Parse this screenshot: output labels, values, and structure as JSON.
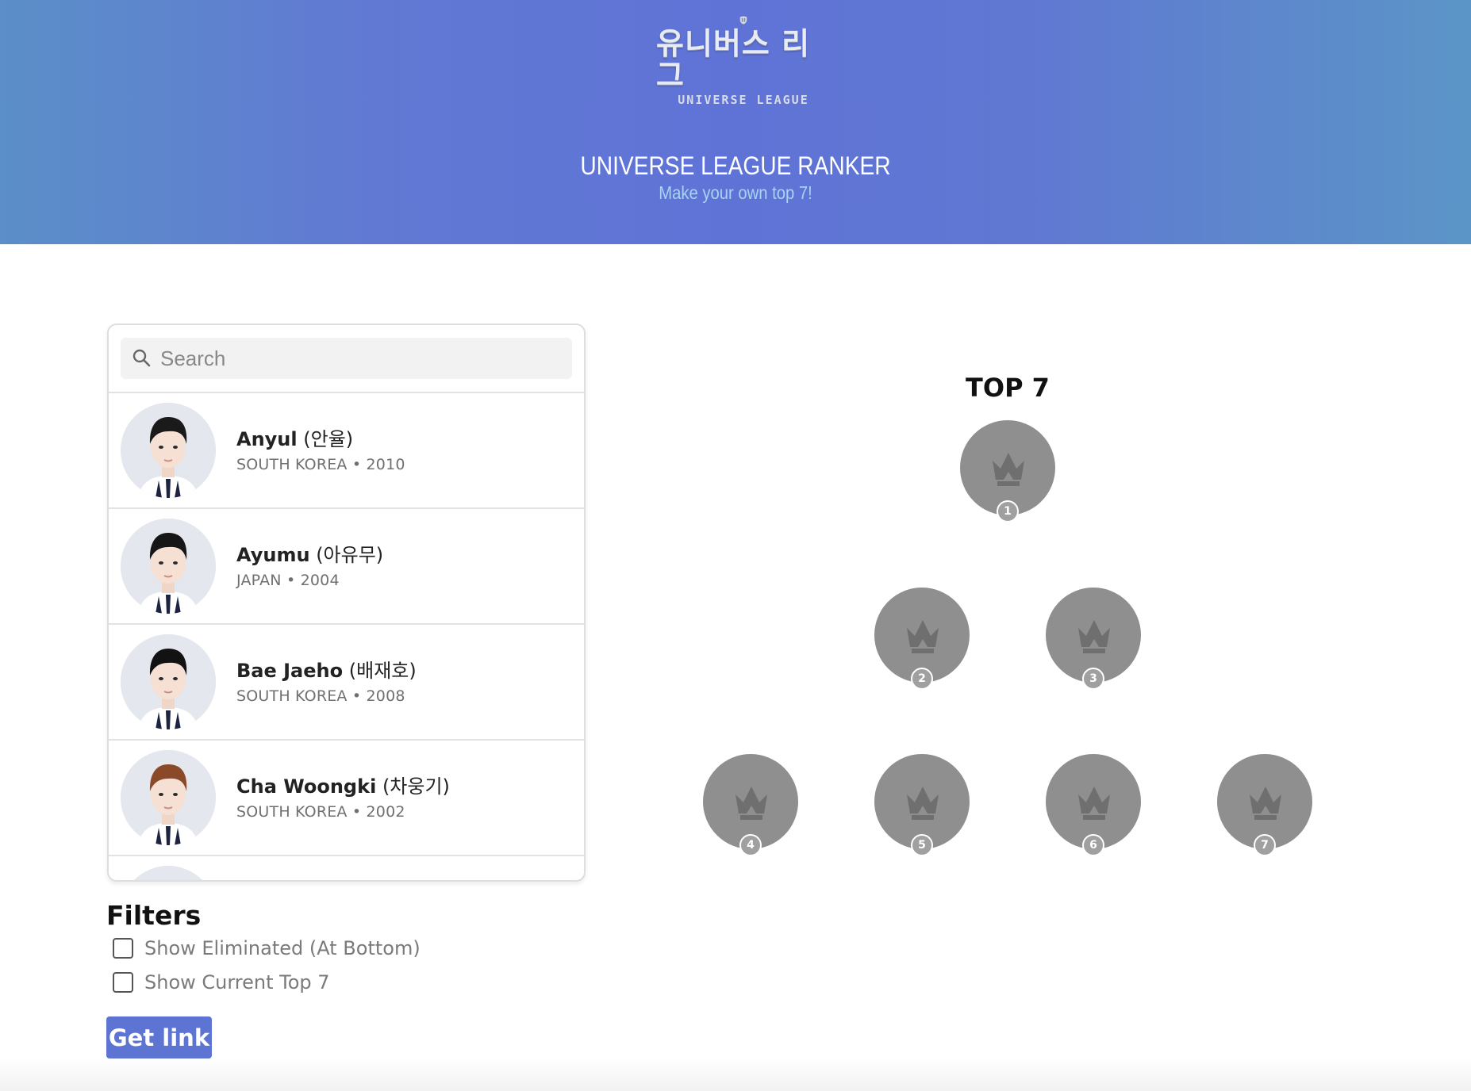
{
  "header": {
    "logo_korean": "유니버스 리그",
    "logo_english": "UNIVERSE LEAGUE",
    "title": "UNIVERSE LEAGUE RANKER",
    "subtitle": "Make your own top 7!"
  },
  "search": {
    "placeholder": "Search",
    "value": ""
  },
  "trainees": [
    {
      "name": "Anyul",
      "korean": "(안율)",
      "meta": "SOUTH KOREA • 2010",
      "hair": "#1a1a1a"
    },
    {
      "name": "Ayumu",
      "korean": "(아유무)",
      "meta": "JAPAN • 2004",
      "hair": "#161616"
    },
    {
      "name": "Bae Jaeho",
      "korean": "(배재호)",
      "meta": "SOUTH KOREA • 2008",
      "hair": "#121212"
    },
    {
      "name": "Cha Woongki",
      "korean": "(차웅기)",
      "meta": "SOUTH KOREA • 2002",
      "hair": "#8a4a2a"
    },
    {
      "name": "",
      "korean": "",
      "meta": "",
      "hair": "#151515"
    }
  ],
  "filters": {
    "title": "Filters",
    "show_eliminated": {
      "label": "Show Eliminated (At Bottom)",
      "checked": false
    },
    "show_current_top": {
      "label": "Show Current Top 7",
      "checked": false
    }
  },
  "get_link_label": "Get link",
  "ranking": {
    "title": "TOP 7",
    "slots": [
      "1",
      "2",
      "3",
      "4",
      "5",
      "6",
      "7"
    ]
  },
  "colors": {
    "banner": "#5f73d6",
    "button": "#5d74d3",
    "slot": "#8f8f8f"
  }
}
